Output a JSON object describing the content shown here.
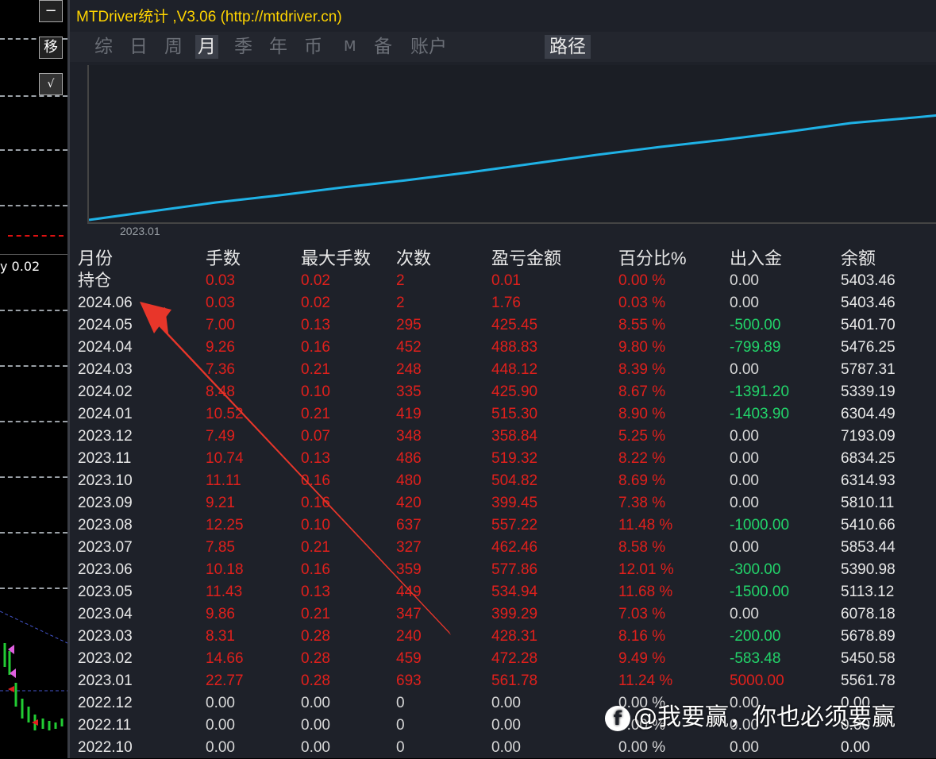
{
  "window": {
    "title": "MTDriver统计 ,V3.06 (http://mtdriver.cn)"
  },
  "left_panel": {
    "buttons": [
      "−",
      "移",
      "√"
    ],
    "tag": "y 0.02"
  },
  "tabs": [
    {
      "label": "综",
      "active": false
    },
    {
      "label": "日",
      "active": false
    },
    {
      "label": "周",
      "active": false
    },
    {
      "label": "月",
      "active": true
    },
    {
      "label": "季",
      "active": false
    },
    {
      "label": "年",
      "active": false
    },
    {
      "label": "币",
      "active": false
    },
    {
      "label": "M",
      "active": false
    },
    {
      "label": "备",
      "active": false
    },
    {
      "label": "账户",
      "active": false
    }
  ],
  "path_button": "路径",
  "chart": {
    "x_label": "2023.01",
    "line_color": "#1fb2e6"
  },
  "table": {
    "headers": [
      "月份",
      "手数",
      "最大手数",
      "次数",
      "盈亏金额",
      "百分比%",
      "出入金",
      "余额"
    ],
    "rows": [
      [
        "持仓",
        "0.03",
        "0.02",
        "2",
        "0.01",
        "0.00 %",
        "0.00",
        "5403.46"
      ],
      [
        "2024.06",
        "0.03",
        "0.02",
        "2",
        "1.76",
        "0.03 %",
        "0.00",
        "5403.46"
      ],
      [
        "2024.05",
        "7.00",
        "0.13",
        "295",
        "425.45",
        "8.55 %",
        "-500.00",
        "5401.70"
      ],
      [
        "2024.04",
        "9.26",
        "0.16",
        "452",
        "488.83",
        "9.80 %",
        "-799.89",
        "5476.25"
      ],
      [
        "2024.03",
        "7.36",
        "0.21",
        "248",
        "448.12",
        "8.39 %",
        "0.00",
        "5787.31"
      ],
      [
        "2024.02",
        "8.48",
        "0.10",
        "335",
        "425.90",
        "8.67 %",
        "-1391.20",
        "5339.19"
      ],
      [
        "2024.01",
        "10.52",
        "0.21",
        "419",
        "515.30",
        "8.90 %",
        "-1403.90",
        "6304.49"
      ],
      [
        "2023.12",
        "7.49",
        "0.07",
        "348",
        "358.84",
        "5.25 %",
        "0.00",
        "7193.09"
      ],
      [
        "2023.11",
        "10.74",
        "0.13",
        "486",
        "519.32",
        "8.22 %",
        "0.00",
        "6834.25"
      ],
      [
        "2023.10",
        "11.11",
        "0.16",
        "480",
        "504.82",
        "8.69 %",
        "0.00",
        "6314.93"
      ],
      [
        "2023.09",
        "9.21",
        "0.16",
        "420",
        "399.45",
        "7.38 %",
        "0.00",
        "5810.11"
      ],
      [
        "2023.08",
        "12.25",
        "0.10",
        "637",
        "557.22",
        "11.48 %",
        "-1000.00",
        "5410.66"
      ],
      [
        "2023.07",
        "7.85",
        "0.21",
        "327",
        "462.46",
        "8.58 %",
        "0.00",
        "5853.44"
      ],
      [
        "2023.06",
        "10.18",
        "0.16",
        "359",
        "577.86",
        "12.01 %",
        "-300.00",
        "5390.98"
      ],
      [
        "2023.05",
        "11.43",
        "0.13",
        "449",
        "534.94",
        "11.68 %",
        "-1500.00",
        "5113.12"
      ],
      [
        "2023.04",
        "9.86",
        "0.21",
        "347",
        "399.29",
        "7.03 %",
        "0.00",
        "6078.18"
      ],
      [
        "2023.03",
        "8.31",
        "0.28",
        "240",
        "428.31",
        "8.16 %",
        "-200.00",
        "5678.89"
      ],
      [
        "2023.02",
        "14.66",
        "0.28",
        "459",
        "472.28",
        "9.49 %",
        "-583.48",
        "5450.58"
      ],
      [
        "2023.01",
        "22.77",
        "0.28",
        "693",
        "561.78",
        "11.24 %",
        "5000.00",
        "5561.78"
      ],
      [
        "2022.12",
        "0.00",
        "0.00",
        "0",
        "0.00",
        "0.00 %",
        "0.00",
        "0.00"
      ],
      [
        "2022.11",
        "0.00",
        "0.00",
        "0",
        "0.00",
        "0.00 %",
        "0.00",
        "0.00"
      ],
      [
        "2022.10",
        "0.00",
        "0.00",
        "0",
        "0.00",
        "0.00 %",
        "0.00",
        "0.00"
      ]
    ]
  },
  "watermark": "@我要赢，你也必须要赢",
  "colors": {
    "positive": "#e0201c",
    "cash": "#22d46a",
    "text": "#e8e8e8",
    "zero": "#d8d8d8"
  }
}
